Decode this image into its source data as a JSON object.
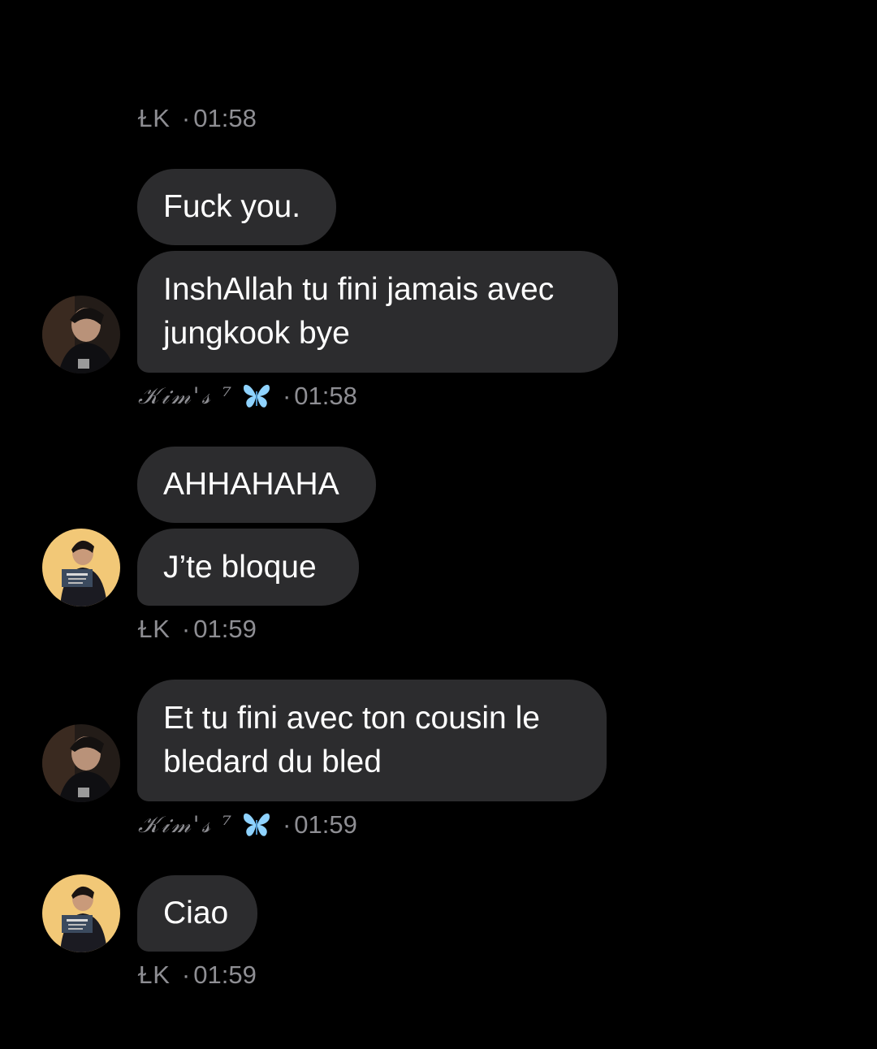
{
  "colors": {
    "background": "#000000",
    "bubble": "#2c2c2e",
    "meta_text": "#8e8e93",
    "butterfly": "#8fd3ff"
  },
  "messages": [
    {
      "sender": "ⱢK",
      "time": "01:58",
      "bubbles": [
        "Fuck you.",
        "InshAllah tu fini jamais avec jungkook bye"
      ]
    },
    {
      "sender": "𝒦𝒾𝓂'𝓈 ⁷",
      "sender_icon": "butterfly-icon",
      "time": "01:58",
      "bubbles": [
        "AHHAHAHA",
        "J’te bloque"
      ]
    },
    {
      "sender": "ⱢK",
      "time": "01:59",
      "bubbles": [
        "Et tu fini avec ton cousin le bledard du bled"
      ]
    },
    {
      "sender": "𝒦𝒾𝓂'𝓈 ⁷",
      "sender_icon": "butterfly-icon",
      "time": "01:59",
      "bubbles": [
        "Ciao"
      ]
    },
    {
      "sender": "ⱢK",
      "time": "01:59"
    }
  ],
  "separator": "·"
}
